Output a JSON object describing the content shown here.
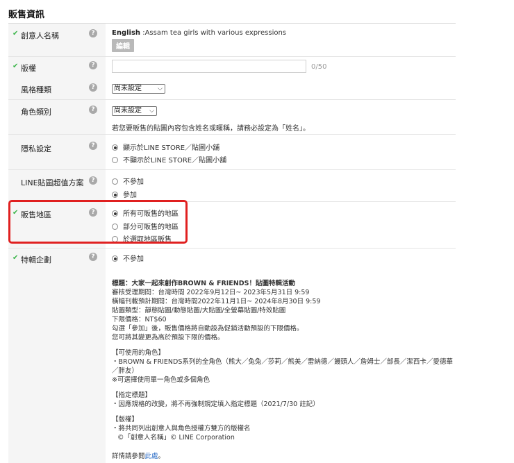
{
  "page_title": "販售資訊",
  "rows": {
    "creator": {
      "label": "創意人名稱",
      "checked": true,
      "english_prefix": "English",
      "english_value": " :Assam tea girls with various expressions",
      "edit_label": "編輯"
    },
    "copyright": {
      "label": "版權",
      "checked": true,
      "input_value": "",
      "counter": "0/50"
    },
    "style": {
      "label": "風格種類",
      "select_value": "尚未設定"
    },
    "character": {
      "label": "角色類別",
      "select_value": "尚未設定",
      "note": "若您要販售的貼圖內容包含姓名或暱稱，請務必設定為「姓名」。"
    },
    "privacy": {
      "label": "隱私設定",
      "options": [
        "顯示於LINE STORE／貼圖小舖",
        "不顯示於LINE STORE／貼圖小舖"
      ],
      "selected": 0
    },
    "value_plan": {
      "label": "LINE貼圖超值方案",
      "options": [
        "不參加",
        "參加"
      ],
      "selected": 1
    },
    "region": {
      "label": "販售地區",
      "checked": true,
      "options": [
        "所有可販售的地區",
        "部分可販售的地區",
        "於選取地區販售"
      ],
      "selected": 0
    },
    "special": {
      "label": "特輯企劃",
      "checked": true,
      "options": [
        "不參加"
      ],
      "selected": 0
    }
  },
  "special_description": {
    "title": "標題：大家一起來創作BROWN & FRIENDS！貼圖特輯活動",
    "lines": [
      "審核受理期間：台灣時間 2022年9月12日~ 2023年5月31日 9:59",
      "橫幅刊載預計期間：台灣時間2022年11月1日~ 2024年8月30日 9:59",
      "貼圖類型：靜態貼圖/動態貼圖/大貼圖/全螢幕貼圖/特效貼圖",
      "下限價格：NT$60",
      "勾選「參加」後，販售價格將自動設為促銷活動預設的下限價格。",
      "您可將其變更為高於預設下限的價格。"
    ],
    "char_header": "【可使用的角色】",
    "char_lines": [
      "・BROWN & FRIENDS系列的全角色（熊大／兔兔／莎莉／熊美／雷納德／饅頭人／詹姆士／部長／潔西卡／愛德華",
      "／胖友）",
      "※可選擇使用單一角色或多個角色"
    ],
    "title_header": "【指定標題】",
    "title_lines": [
      "・因應規格的改變，將不再強制規定填入指定標題（2021/7/30 註記）"
    ],
    "copyright_header": "【版權】",
    "copyright_lines": [
      "・將共同列出創意人與角色授權方雙方的版權名",
      "©「創意人名稱」© LINE Corporation"
    ],
    "more_prefix": "詳情請參閱",
    "more_link": "此處",
    "more_suffix": "。"
  },
  "colors": {
    "check": "#3bb54a",
    "highlight": "#e02020",
    "link": "#2468c4"
  }
}
